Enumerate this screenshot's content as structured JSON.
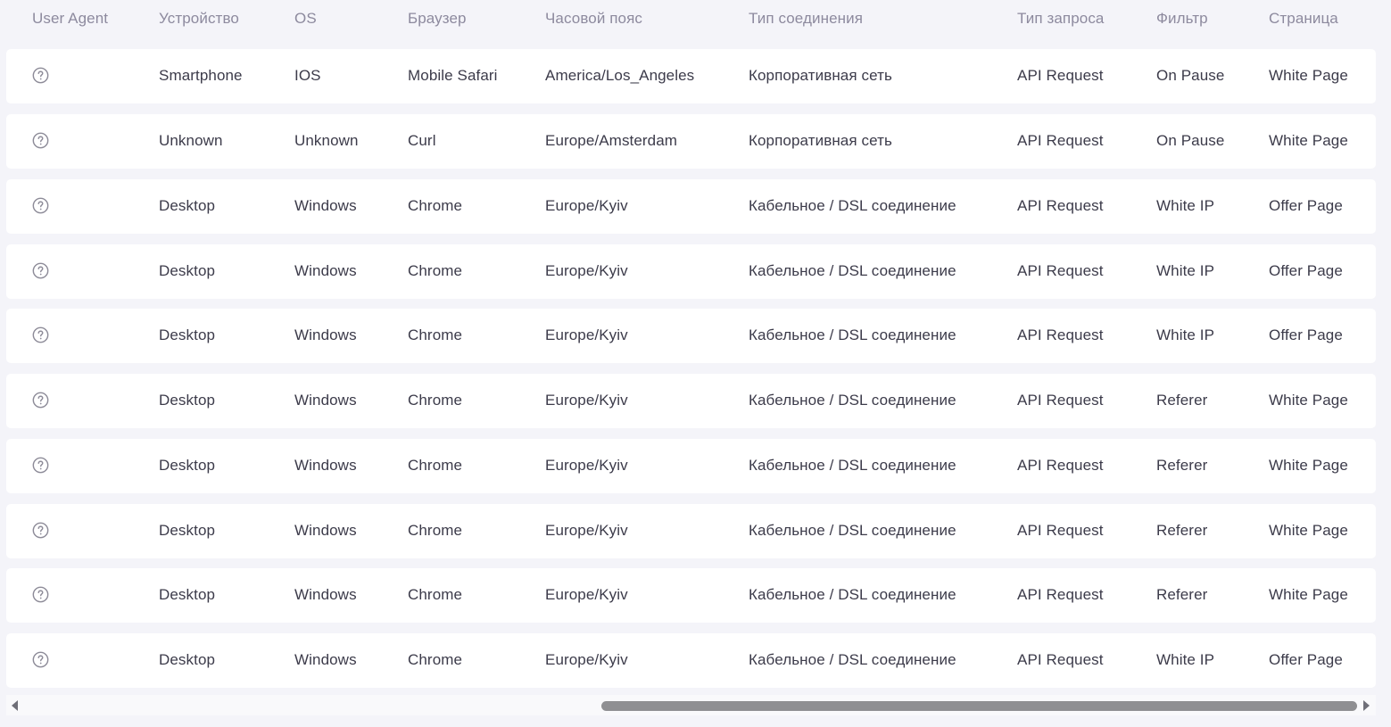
{
  "columns": [
    "User Agent",
    "Устройство",
    "OS",
    "Браузер",
    "Часовой пояс",
    "Тип соединения",
    "Тип запроса",
    "Фильтр",
    "Страница"
  ],
  "ua_icon": "question-circle-icon",
  "rows": [
    {
      "device": "Smartphone",
      "os": "IOS",
      "browser": "Mobile Safari",
      "timezone": "America/Los_Angeles",
      "connection": "Корпоративная сеть",
      "request": "API Request",
      "filter": "On Pause",
      "page": "White Page"
    },
    {
      "device": "Unknown",
      "os": "Unknown",
      "browser": "Curl",
      "timezone": "Europe/Amsterdam",
      "connection": "Корпоративная сеть",
      "request": "API Request",
      "filter": "On Pause",
      "page": "White Page"
    },
    {
      "device": "Desktop",
      "os": "Windows",
      "browser": "Chrome",
      "timezone": "Europe/Kyiv",
      "connection": "Кабельное / DSL соединение",
      "request": "API Request",
      "filter": "White IP",
      "page": "Offer Page"
    },
    {
      "device": "Desktop",
      "os": "Windows",
      "browser": "Chrome",
      "timezone": "Europe/Kyiv",
      "connection": "Кабельное / DSL соединение",
      "request": "API Request",
      "filter": "White IP",
      "page": "Offer Page"
    },
    {
      "device": "Desktop",
      "os": "Windows",
      "browser": "Chrome",
      "timezone": "Europe/Kyiv",
      "connection": "Кабельное / DSL соединение",
      "request": "API Request",
      "filter": "White IP",
      "page": "Offer Page"
    },
    {
      "device": "Desktop",
      "os": "Windows",
      "browser": "Chrome",
      "timezone": "Europe/Kyiv",
      "connection": "Кабельное / DSL соединение",
      "request": "API Request",
      "filter": "Referer",
      "page": "White Page"
    },
    {
      "device": "Desktop",
      "os": "Windows",
      "browser": "Chrome",
      "timezone": "Europe/Kyiv",
      "connection": "Кабельное / DSL соединение",
      "request": "API Request",
      "filter": "Referer",
      "page": "White Page"
    },
    {
      "device": "Desktop",
      "os": "Windows",
      "browser": "Chrome",
      "timezone": "Europe/Kyiv",
      "connection": "Кабельное / DSL соединение",
      "request": "API Request",
      "filter": "Referer",
      "page": "White Page"
    },
    {
      "device": "Desktop",
      "os": "Windows",
      "browser": "Chrome",
      "timezone": "Europe/Kyiv",
      "connection": "Кабельное / DSL соединение",
      "request": "API Request",
      "filter": "Referer",
      "page": "White Page"
    },
    {
      "device": "Desktop",
      "os": "Windows",
      "browser": "Chrome",
      "timezone": "Europe/Kyiv",
      "connection": "Кабельное / DSL соединение",
      "request": "API Request",
      "filter": "White IP",
      "page": "Offer Page"
    }
  ],
  "scrollbar": {
    "left_icon": "arrow-left-icon",
    "right_icon": "arrow-right-icon",
    "position": 0.45
  }
}
